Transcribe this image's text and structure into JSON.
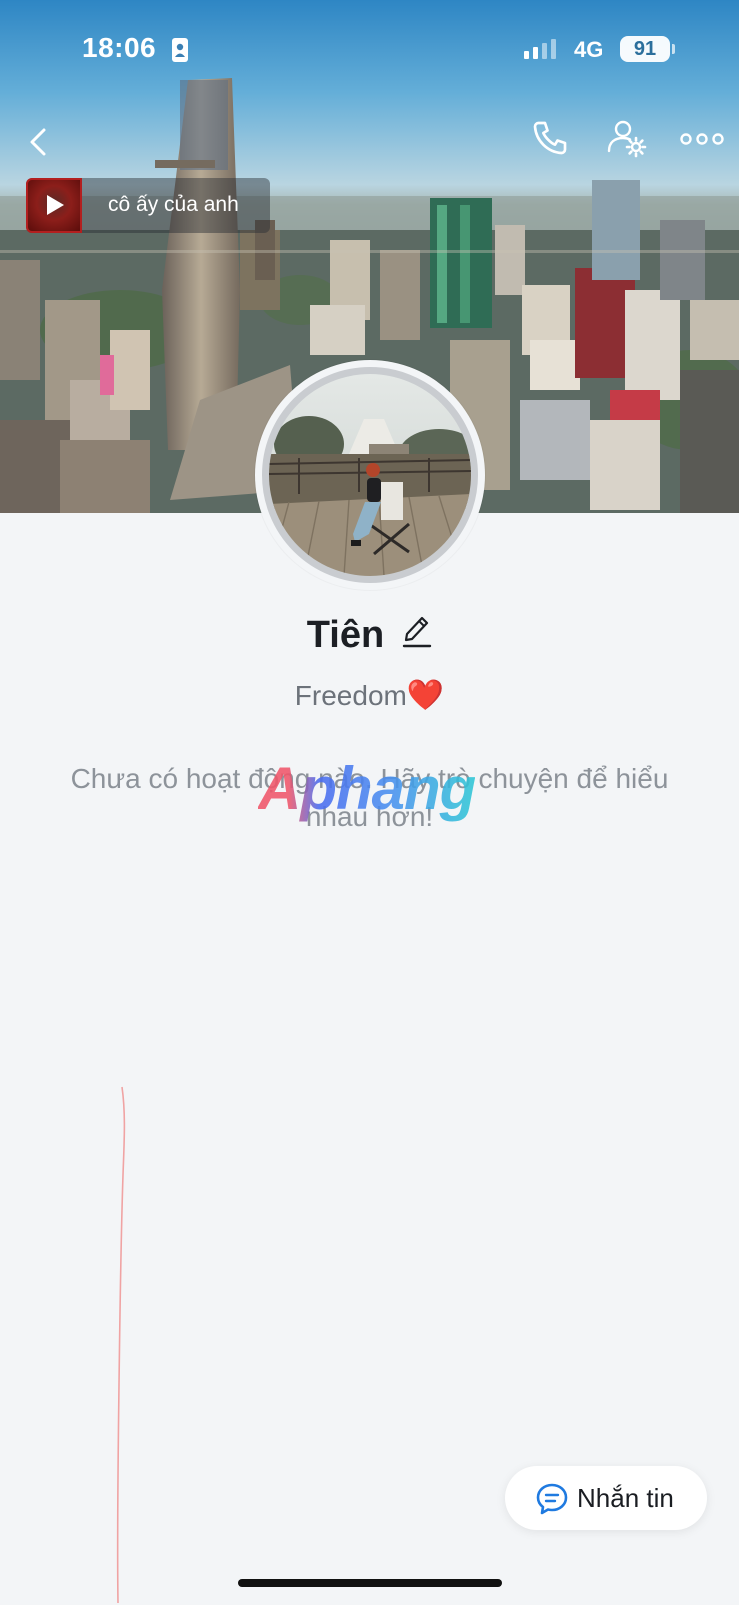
{
  "status_bar": {
    "time": "18:06",
    "network": "4G",
    "battery": "91"
  },
  "nav": {
    "back_icon": "chevron-left-icon",
    "call_icon": "phone-icon",
    "settings_icon": "user-gear-icon",
    "more_icon": "ellipsis-icon"
  },
  "music": {
    "title": "cô ấy của anh",
    "icon": "play-icon"
  },
  "profile": {
    "name": "Tiên",
    "bio_text": "Freedom",
    "bio_emoji": "❤️",
    "edit_icon": "pencil-icon"
  },
  "activity": {
    "empty_message": "Chưa có hoạt động nào. Hãy trò chuyện để hiểu nhau hơn!"
  },
  "watermark": {
    "text": "Aphang"
  },
  "message_button": {
    "label": "Nhắn tin",
    "icon": "chat-bubble-icon"
  },
  "colors": {
    "background": "#f3f5f7",
    "message_icon": "#1f7ae0",
    "heart": "#e32320"
  }
}
